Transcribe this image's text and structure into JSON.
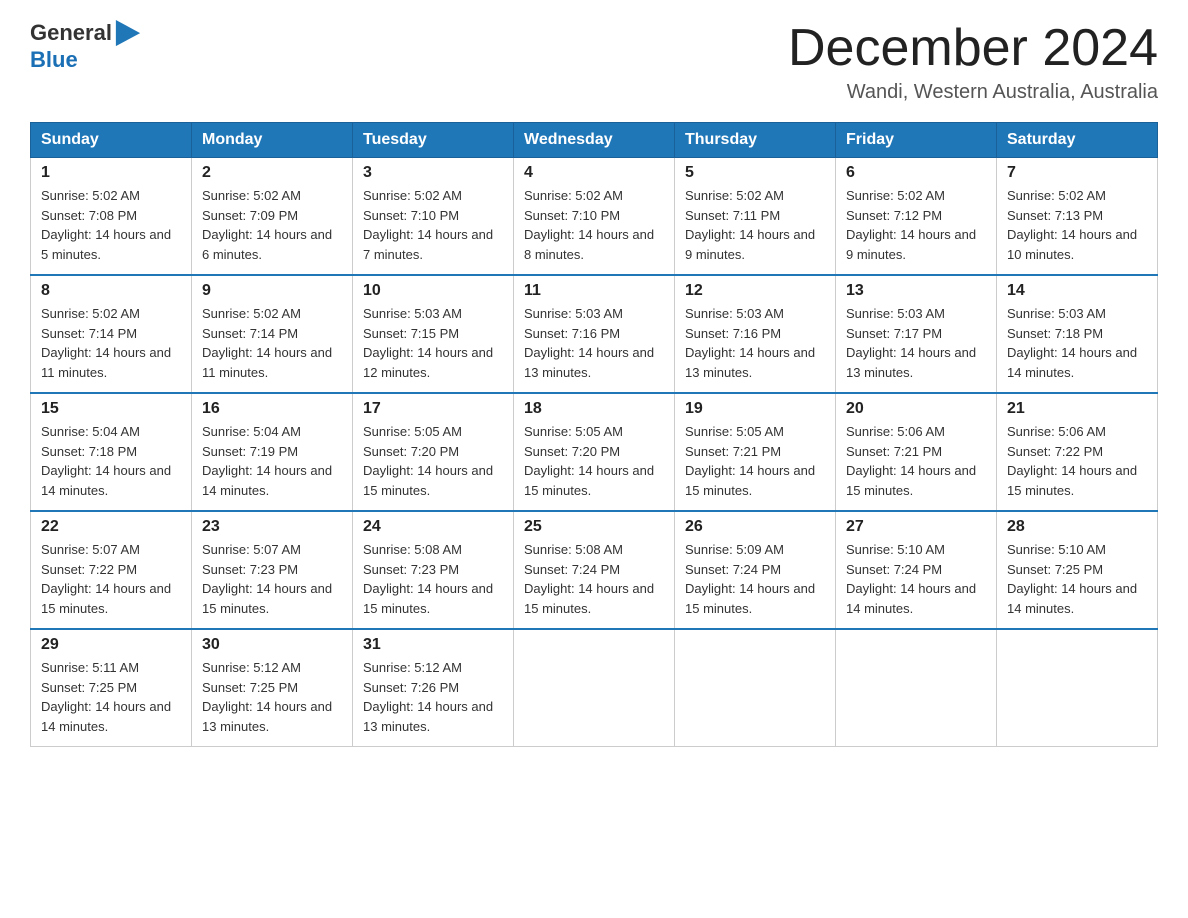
{
  "header": {
    "logo_general": "General",
    "logo_blue": "Blue",
    "month_title": "December 2024",
    "location": "Wandi, Western Australia, Australia"
  },
  "days_of_week": [
    "Sunday",
    "Monday",
    "Tuesday",
    "Wednesday",
    "Thursday",
    "Friday",
    "Saturday"
  ],
  "weeks": [
    [
      {
        "day": "1",
        "sunrise": "5:02 AM",
        "sunset": "7:08 PM",
        "daylight": "14 hours and 5 minutes."
      },
      {
        "day": "2",
        "sunrise": "5:02 AM",
        "sunset": "7:09 PM",
        "daylight": "14 hours and 6 minutes."
      },
      {
        "day": "3",
        "sunrise": "5:02 AM",
        "sunset": "7:10 PM",
        "daylight": "14 hours and 7 minutes."
      },
      {
        "day": "4",
        "sunrise": "5:02 AM",
        "sunset": "7:10 PM",
        "daylight": "14 hours and 8 minutes."
      },
      {
        "day": "5",
        "sunrise": "5:02 AM",
        "sunset": "7:11 PM",
        "daylight": "14 hours and 9 minutes."
      },
      {
        "day": "6",
        "sunrise": "5:02 AM",
        "sunset": "7:12 PM",
        "daylight": "14 hours and 9 minutes."
      },
      {
        "day": "7",
        "sunrise": "5:02 AM",
        "sunset": "7:13 PM",
        "daylight": "14 hours and 10 minutes."
      }
    ],
    [
      {
        "day": "8",
        "sunrise": "5:02 AM",
        "sunset": "7:14 PM",
        "daylight": "14 hours and 11 minutes."
      },
      {
        "day": "9",
        "sunrise": "5:02 AM",
        "sunset": "7:14 PM",
        "daylight": "14 hours and 11 minutes."
      },
      {
        "day": "10",
        "sunrise": "5:03 AM",
        "sunset": "7:15 PM",
        "daylight": "14 hours and 12 minutes."
      },
      {
        "day": "11",
        "sunrise": "5:03 AM",
        "sunset": "7:16 PM",
        "daylight": "14 hours and 13 minutes."
      },
      {
        "day": "12",
        "sunrise": "5:03 AM",
        "sunset": "7:16 PM",
        "daylight": "14 hours and 13 minutes."
      },
      {
        "day": "13",
        "sunrise": "5:03 AM",
        "sunset": "7:17 PM",
        "daylight": "14 hours and 13 minutes."
      },
      {
        "day": "14",
        "sunrise": "5:03 AM",
        "sunset": "7:18 PM",
        "daylight": "14 hours and 14 minutes."
      }
    ],
    [
      {
        "day": "15",
        "sunrise": "5:04 AM",
        "sunset": "7:18 PM",
        "daylight": "14 hours and 14 minutes."
      },
      {
        "day": "16",
        "sunrise": "5:04 AM",
        "sunset": "7:19 PM",
        "daylight": "14 hours and 14 minutes."
      },
      {
        "day": "17",
        "sunrise": "5:05 AM",
        "sunset": "7:20 PM",
        "daylight": "14 hours and 15 minutes."
      },
      {
        "day": "18",
        "sunrise": "5:05 AM",
        "sunset": "7:20 PM",
        "daylight": "14 hours and 15 minutes."
      },
      {
        "day": "19",
        "sunrise": "5:05 AM",
        "sunset": "7:21 PM",
        "daylight": "14 hours and 15 minutes."
      },
      {
        "day": "20",
        "sunrise": "5:06 AM",
        "sunset": "7:21 PM",
        "daylight": "14 hours and 15 minutes."
      },
      {
        "day": "21",
        "sunrise": "5:06 AM",
        "sunset": "7:22 PM",
        "daylight": "14 hours and 15 minutes."
      }
    ],
    [
      {
        "day": "22",
        "sunrise": "5:07 AM",
        "sunset": "7:22 PM",
        "daylight": "14 hours and 15 minutes."
      },
      {
        "day": "23",
        "sunrise": "5:07 AM",
        "sunset": "7:23 PM",
        "daylight": "14 hours and 15 minutes."
      },
      {
        "day": "24",
        "sunrise": "5:08 AM",
        "sunset": "7:23 PM",
        "daylight": "14 hours and 15 minutes."
      },
      {
        "day": "25",
        "sunrise": "5:08 AM",
        "sunset": "7:24 PM",
        "daylight": "14 hours and 15 minutes."
      },
      {
        "day": "26",
        "sunrise": "5:09 AM",
        "sunset": "7:24 PM",
        "daylight": "14 hours and 15 minutes."
      },
      {
        "day": "27",
        "sunrise": "5:10 AM",
        "sunset": "7:24 PM",
        "daylight": "14 hours and 14 minutes."
      },
      {
        "day": "28",
        "sunrise": "5:10 AM",
        "sunset": "7:25 PM",
        "daylight": "14 hours and 14 minutes."
      }
    ],
    [
      {
        "day": "29",
        "sunrise": "5:11 AM",
        "sunset": "7:25 PM",
        "daylight": "14 hours and 14 minutes."
      },
      {
        "day": "30",
        "sunrise": "5:12 AM",
        "sunset": "7:25 PM",
        "daylight": "14 hours and 13 minutes."
      },
      {
        "day": "31",
        "sunrise": "5:12 AM",
        "sunset": "7:26 PM",
        "daylight": "14 hours and 13 minutes."
      },
      null,
      null,
      null,
      null
    ]
  ]
}
